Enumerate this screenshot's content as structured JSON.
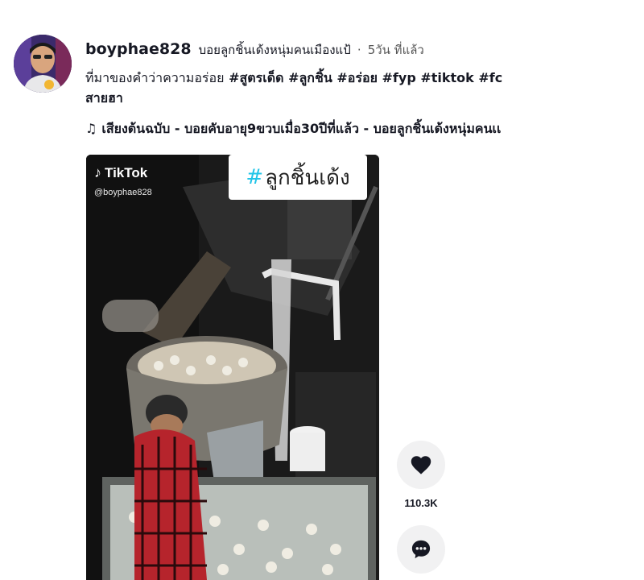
{
  "post": {
    "username": "boyphae828",
    "nickname": "บอยลูกชิ้นเด้งหนุ่มคนเมืองแป้",
    "separator": "·",
    "posted_ago": "5วัน ที่แล้ว",
    "caption_text": "ที่มาของคำว่าความอร่อย",
    "hashtags": [
      "#สูตรเด็ด",
      "#ลูกชิ้น",
      "#อร่อย",
      "#fyp",
      "#tiktok",
      "#fc",
      "สายฮา"
    ],
    "music_note": "♫",
    "music": "เสียงต้นฉบับ - บอยคับอายุ9ขวบเมื่อ30ปีที่แล้ว - บอยลูกชิ้นเด้งหนุ่มคนเเ"
  },
  "video": {
    "tiktok_brand": "TikTok",
    "tiktok_handle": "@boyphae828",
    "overlay_hash": "#",
    "overlay_text": "ลูกชิ้นเด้ง"
  },
  "actions": {
    "like_icon": "heart-icon",
    "like_count": "110.3K",
    "comment_icon": "comment-icon"
  },
  "colors": {
    "text": "#161823",
    "action_bg": "#f1f1f2",
    "overlay_hash": "#20c4e8"
  }
}
